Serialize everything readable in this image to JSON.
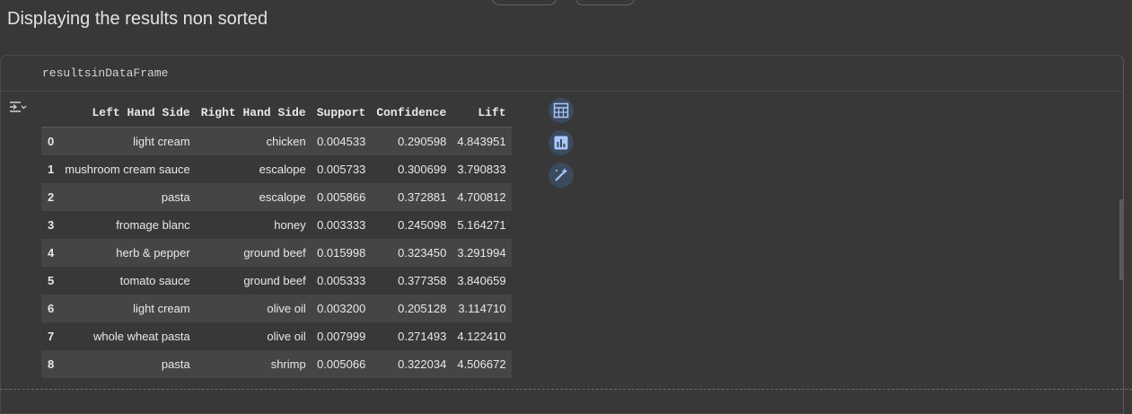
{
  "page": {
    "title": "Displaying the results non sorted"
  },
  "cell": {
    "code": "resultsinDataFrame"
  },
  "table": {
    "columns": [
      "",
      "Left Hand Side",
      "Right Hand Side",
      "Support",
      "Confidence",
      "Lift"
    ],
    "rows": [
      {
        "index": "0",
        "lhs": "light cream",
        "rhs": "chicken",
        "support": "0.004533",
        "confidence": "0.290598",
        "lift": "4.843951"
      },
      {
        "index": "1",
        "lhs": "mushroom cream sauce",
        "rhs": "escalope",
        "support": "0.005733",
        "confidence": "0.300699",
        "lift": "3.790833"
      },
      {
        "index": "2",
        "lhs": "pasta",
        "rhs": "escalope",
        "support": "0.005866",
        "confidence": "0.372881",
        "lift": "4.700812"
      },
      {
        "index": "3",
        "lhs": "fromage blanc",
        "rhs": "honey",
        "support": "0.003333",
        "confidence": "0.245098",
        "lift": "5.164271"
      },
      {
        "index": "4",
        "lhs": "herb & pepper",
        "rhs": "ground beef",
        "support": "0.015998",
        "confidence": "0.323450",
        "lift": "3.291994"
      },
      {
        "index": "5",
        "lhs": "tomato sauce",
        "rhs": "ground beef",
        "support": "0.005333",
        "confidence": "0.377358",
        "lift": "3.840659"
      },
      {
        "index": "6",
        "lhs": "light cream",
        "rhs": "olive oil",
        "support": "0.003200",
        "confidence": "0.205128",
        "lift": "3.114710"
      },
      {
        "index": "7",
        "lhs": "whole wheat pasta",
        "rhs": "olive oil",
        "support": "0.007999",
        "confidence": "0.271493",
        "lift": "4.122410"
      },
      {
        "index": "8",
        "lhs": "pasta",
        "rhs": "shrimp",
        "support": "0.005066",
        "confidence": "0.322034",
        "lift": "4.506672"
      }
    ]
  },
  "icons": {
    "output_toggle": "output-toggle-icon",
    "table_view": "table-icon",
    "chart_suggest": "bar-chart-icon",
    "magic_edit": "magic-wand-icon"
  },
  "colors": {
    "background": "#383838",
    "row_stripe": "#454545",
    "icon_bg": "#3c4a5e",
    "icon_fg": "#a8c7fa"
  }
}
